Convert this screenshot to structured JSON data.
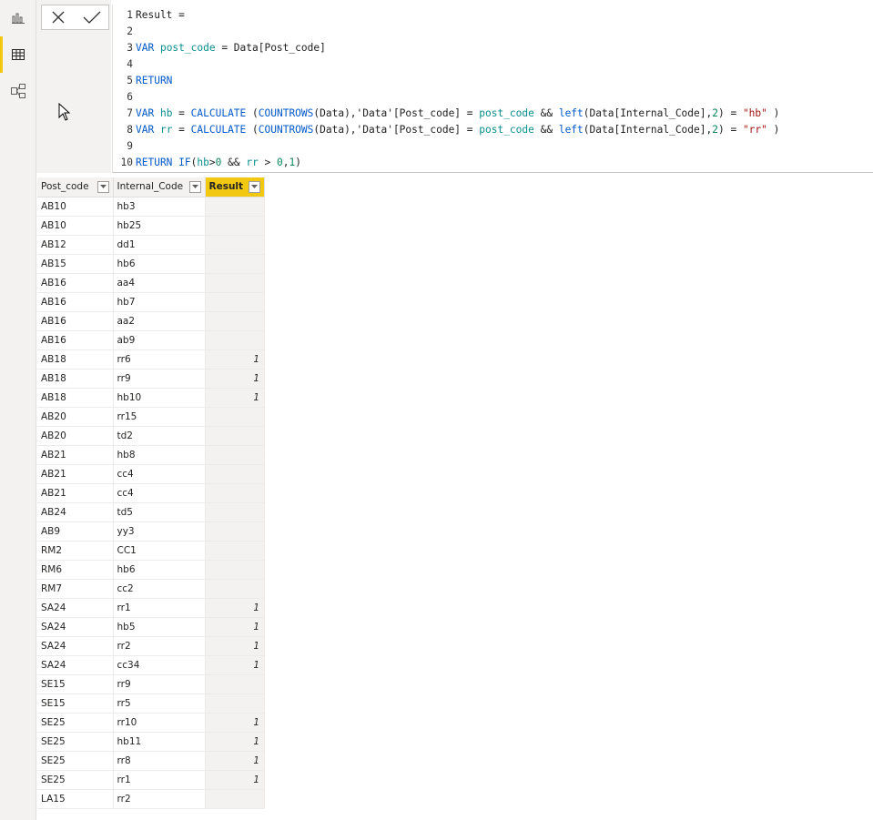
{
  "nav": {
    "items": [
      {
        "name": "report-view",
        "icon": "bar-chart-icon",
        "active": false
      },
      {
        "name": "data-view",
        "icon": "table-grid-icon",
        "active": true
      },
      {
        "name": "model-view",
        "icon": "model-diagram-icon",
        "active": false
      }
    ]
  },
  "formula_bar": {
    "cancel_icon": "close-icon",
    "commit_icon": "checkmark-icon",
    "lines": [
      {
        "num": "1",
        "tokens": [
          [
            "txt",
            "Result ="
          ]
        ]
      },
      {
        "num": "2",
        "tokens": []
      },
      {
        "num": "3",
        "tokens": [
          [
            "kw",
            "VAR "
          ],
          [
            "var",
            "post_code"
          ],
          [
            "txt",
            " = Data[Post_code]"
          ]
        ]
      },
      {
        "num": "4",
        "tokens": []
      },
      {
        "num": "5",
        "tokens": [
          [
            "kw",
            "RETURN"
          ]
        ]
      },
      {
        "num": "6",
        "tokens": []
      },
      {
        "num": "7",
        "tokens": [
          [
            "kw",
            "VAR "
          ],
          [
            "var",
            "hb"
          ],
          [
            "txt",
            " = "
          ],
          [
            "fn",
            "CALCULATE"
          ],
          [
            "txt",
            " ("
          ],
          [
            "fn",
            "COUNTROWS"
          ],
          [
            "txt",
            "(Data),'Data'[Post_code] = "
          ],
          [
            "var",
            "post_code"
          ],
          [
            "txt",
            " && "
          ],
          [
            "fn",
            "left"
          ],
          [
            "txt",
            "(Data[Internal_Code],"
          ],
          [
            "num",
            "2"
          ],
          [
            "txt",
            ") = "
          ],
          [
            "str",
            "\"hb\""
          ],
          [
            "txt",
            " )"
          ]
        ]
      },
      {
        "num": "8",
        "tokens": [
          [
            "kw",
            "VAR "
          ],
          [
            "var",
            "rr"
          ],
          [
            "txt",
            " = "
          ],
          [
            "fn",
            "CALCULATE"
          ],
          [
            "txt",
            " ("
          ],
          [
            "fn",
            "COUNTROWS"
          ],
          [
            "txt",
            "(Data),'Data'[Post_code] = "
          ],
          [
            "var",
            "post_code"
          ],
          [
            "txt",
            " && "
          ],
          [
            "fn",
            "left"
          ],
          [
            "txt",
            "(Data[Internal_Code],"
          ],
          [
            "num",
            "2"
          ],
          [
            "txt",
            ") = "
          ],
          [
            "str",
            "\"rr\""
          ],
          [
            "txt",
            " )"
          ]
        ]
      },
      {
        "num": "9",
        "tokens": []
      },
      {
        "num": "10",
        "tokens": [
          [
            "kw",
            "RETURN "
          ],
          [
            "fn",
            "IF"
          ],
          [
            "txt",
            "("
          ],
          [
            "var",
            "hb"
          ],
          [
            "txt",
            ">"
          ],
          [
            "num",
            "0"
          ],
          [
            "txt",
            " && "
          ],
          [
            "var",
            "rr"
          ],
          [
            "txt",
            " > "
          ],
          [
            "num",
            "0"
          ],
          [
            "txt",
            ","
          ],
          [
            "num",
            "1"
          ],
          [
            "txt",
            ")"
          ]
        ]
      }
    ]
  },
  "table": {
    "columns": [
      "Post_code",
      "Internal_Code",
      "Result"
    ],
    "rows": [
      [
        "AB10",
        "hb3",
        ""
      ],
      [
        "AB10",
        "hb25",
        ""
      ],
      [
        "AB12",
        "dd1",
        ""
      ],
      [
        "AB15",
        "hb6",
        ""
      ],
      [
        "AB16",
        "aa4",
        ""
      ],
      [
        "AB16",
        "hb7",
        ""
      ],
      [
        "AB16",
        "aa2",
        ""
      ],
      [
        "AB16",
        "ab9",
        ""
      ],
      [
        "AB18",
        "rr6",
        "1"
      ],
      [
        "AB18",
        "rr9",
        "1"
      ],
      [
        "AB18",
        "hb10",
        "1"
      ],
      [
        "AB20",
        "rr15",
        ""
      ],
      [
        "AB20",
        "td2",
        ""
      ],
      [
        "AB21",
        "hb8",
        ""
      ],
      [
        "AB21",
        "cc4",
        ""
      ],
      [
        "AB21",
        "cc4",
        ""
      ],
      [
        "AB24",
        "td5",
        ""
      ],
      [
        "AB9",
        "yy3",
        ""
      ],
      [
        "RM2",
        "CC1",
        ""
      ],
      [
        "RM6",
        "hb6",
        ""
      ],
      [
        "RM7",
        "cc2",
        ""
      ],
      [
        "SA24",
        "rr1",
        "1"
      ],
      [
        "SA24",
        "hb5",
        "1"
      ],
      [
        "SA24",
        "rr2",
        "1"
      ],
      [
        "SA24",
        "cc34",
        "1"
      ],
      [
        "SE15",
        "rr9",
        ""
      ],
      [
        "SE15",
        "rr5",
        ""
      ],
      [
        "SE25",
        "rr10",
        "1"
      ],
      [
        "SE25",
        "hb11",
        "1"
      ],
      [
        "SE25",
        "rr8",
        "1"
      ],
      [
        "SE25",
        "rr1",
        "1"
      ],
      [
        "LA15",
        "rr2",
        ""
      ]
    ]
  },
  "colors": {
    "accent": "#f2c811",
    "keyword": "#035aca",
    "variable": "#0a8f8f",
    "string": "#a31515",
    "number": "#09885a"
  }
}
